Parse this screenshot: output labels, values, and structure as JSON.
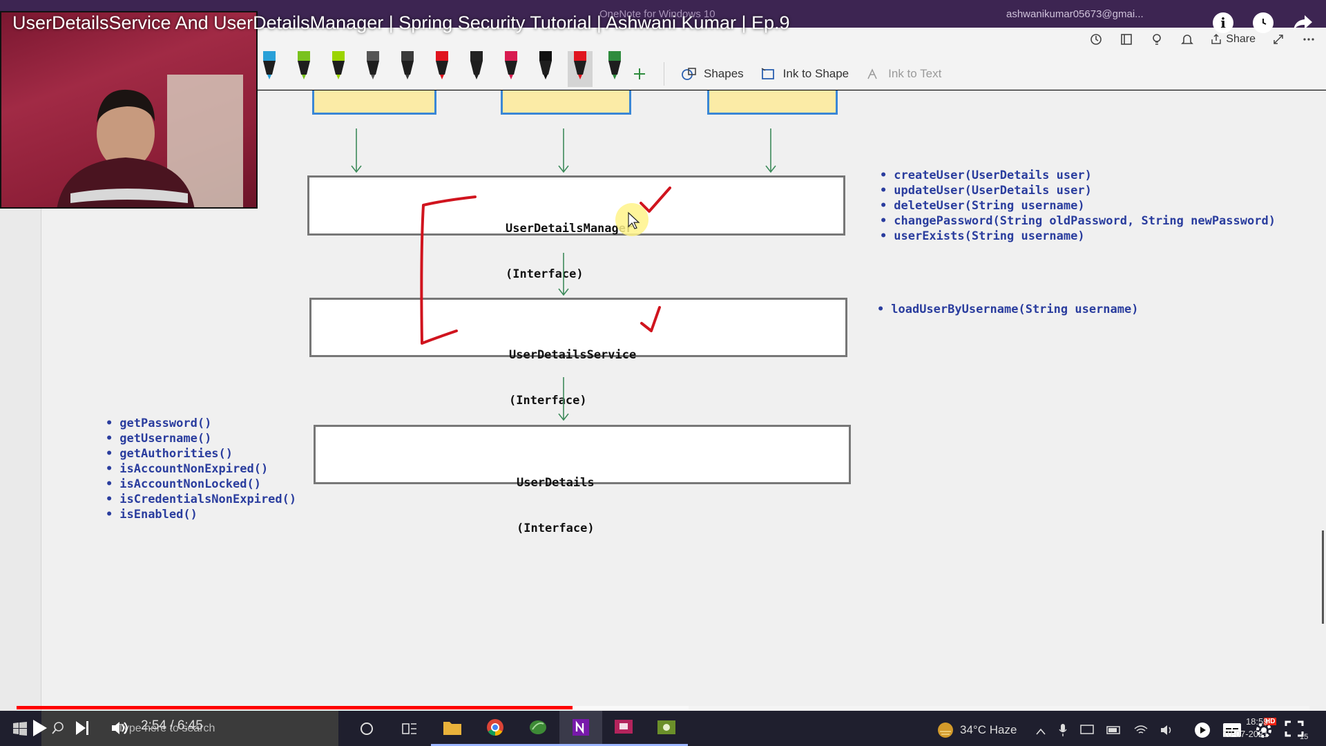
{
  "onenote": {
    "title": "OneNote for Windows 10",
    "account": "ashwanikumar05673@gmai...",
    "share_label": "Share",
    "tools": {
      "shapes": "Shapes",
      "ink_to_shape": "Ink to Shape",
      "ink_to_text": "Ink to Text"
    },
    "pen_colors": [
      "#29a0d8",
      "#79c21e",
      "#9bd400",
      "#555555",
      "#3b3b3b",
      "#e0141e",
      "#222222",
      "#d81b50",
      "#111111",
      "#e0141e",
      "#2e8b3d"
    ]
  },
  "diagram": {
    "manager": {
      "name": "UserDetailsManager",
      "kind": "(Interface)"
    },
    "service": {
      "name": "UserDetailsService",
      "kind": "(Interface)"
    },
    "details": {
      "name": "UserDetails",
      "kind": "(Interface)"
    },
    "manager_methods": [
      "createUser(UserDetails user)",
      "updateUser(UserDetails user)",
      "deleteUser(String username)",
      "changePassword(String oldPassword, String newPassword)",
      "userExists(String username)"
    ],
    "service_methods": [
      "loadUserByUsername(String username)"
    ],
    "details_methods": [
      "getPassword()",
      "getUsername()",
      "getAuthorities()",
      "isAccountNonExpired()",
      "isAccountNonLocked()",
      "isCredentialsNonExpired()",
      "isEnabled()"
    ],
    "ink_color": "#d0141e"
  },
  "youtube": {
    "title": "UserDetailsService And UserDetailsManager | Spring Security Tutorial | Ashwani Kumar | Ep.9",
    "time": "2:54 / 6:45",
    "played_fraction": 0.43,
    "buffered_fraction": 0.52,
    "quality_badge": "HD"
  },
  "taskbar": {
    "search_placeholder": "Type here to search",
    "weather": "34°C  Haze",
    "clock_time": "18:59",
    "clock_date": "10-07-2021",
    "notification_count": "15"
  }
}
